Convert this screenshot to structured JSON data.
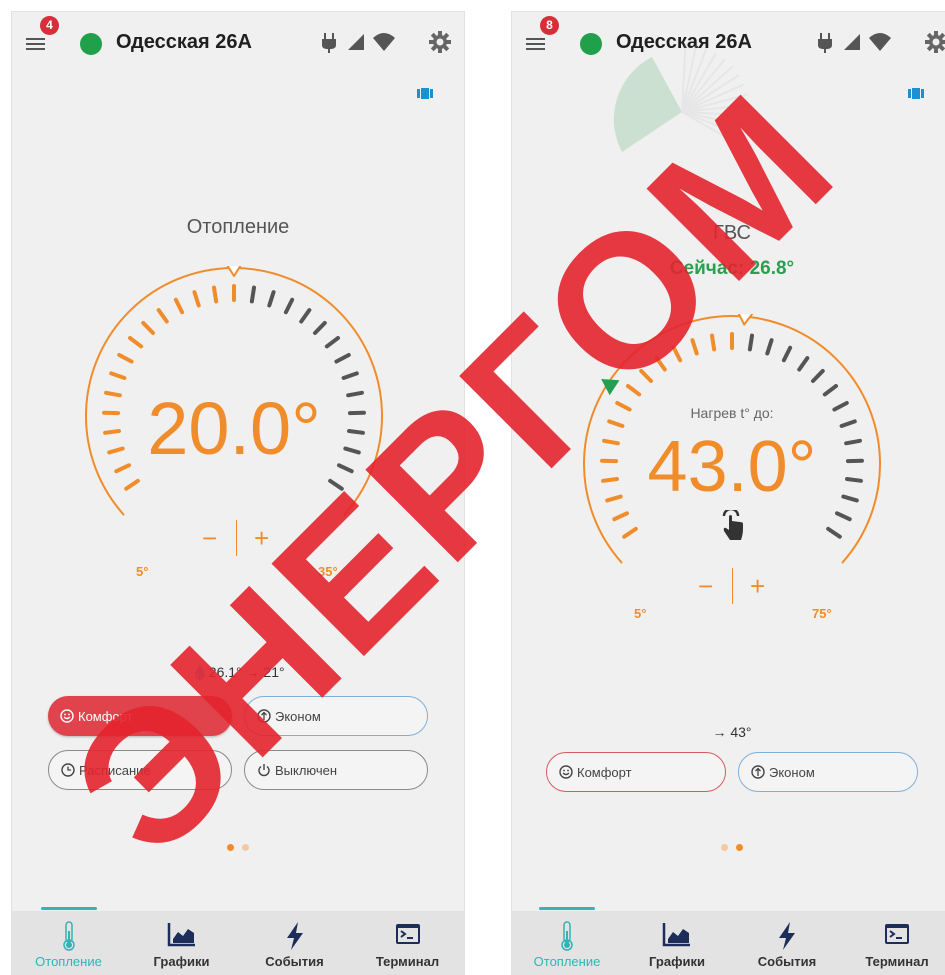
{
  "left": {
    "notifications": "4",
    "device_title": "Одесская 26А",
    "mode_title": "Отопление",
    "target_temp": "20.0°",
    "min_label": "5°",
    "max_label": "35°",
    "minus_label": "−",
    "plus_label": "+",
    "info_text": "💧26.1°  → 21°",
    "modes": [
      "Комфорт",
      "Эконом",
      "Расписание",
      "Выключен"
    ],
    "active_mode": "Комфорт"
  },
  "right": {
    "notifications": "8",
    "device_title": "Одесская 26А",
    "mode_title": "ГВС",
    "now_text": "Сейчас: 26.8°",
    "heat_label": "Нагрев t° до:",
    "target_temp": "43.0°",
    "min_label": "5°",
    "max_label": "75°",
    "minus_label": "−",
    "plus_label": "+",
    "info_text": "→ 43°",
    "modes": [
      "Комфорт",
      "Эконом"
    ]
  },
  "nav": {
    "items": [
      "Отопление",
      "Графики",
      "События",
      "Терминал"
    ],
    "active": "Отопление"
  },
  "colors": {
    "accent_orange": "#f08c2a",
    "active_red": "#e0434c",
    "online_green": "#20a04a",
    "nav_active": "#31b3b8"
  },
  "watermark": "ЭНЕРГОМ"
}
